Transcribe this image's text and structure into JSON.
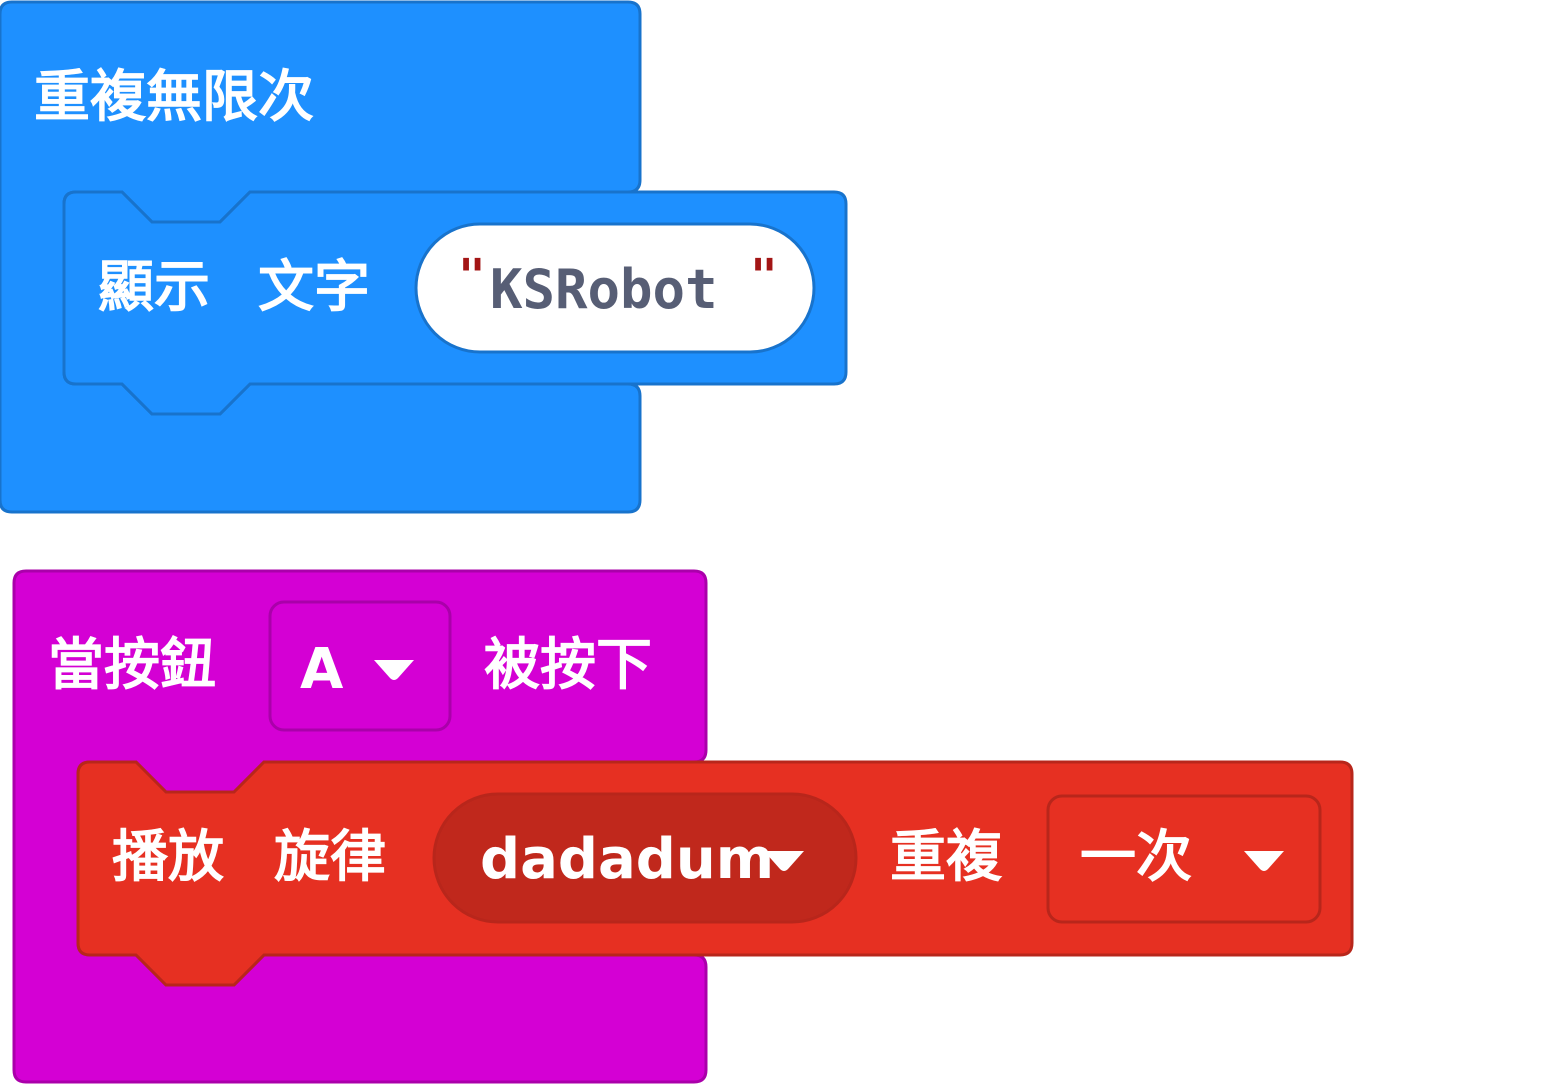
{
  "colors": {
    "loops": "#1e90ff",
    "loops_border": "#1873cc",
    "input": "#d400d4",
    "input_border": "#aa00aa",
    "music": "#e63022",
    "music_border": "#b8261b",
    "music_dark": "#c0281c",
    "string_text": "#575e75",
    "quote": "#a31515"
  },
  "forever_block": {
    "label": "重複無限次",
    "show_string": {
      "label_show": "顯示",
      "label_text": "文字",
      "value": "KSRobot",
      "quote_open": "\"",
      "quote_close": "\""
    }
  },
  "button_block": {
    "label_when": "當按鈕",
    "button_value": "A",
    "label_pressed": "被按下",
    "play_melody": {
      "label_play": "播放",
      "label_melody": "旋律",
      "melody_value": "dadadum",
      "label_repeat": "重複",
      "repeat_value": "一次"
    }
  }
}
